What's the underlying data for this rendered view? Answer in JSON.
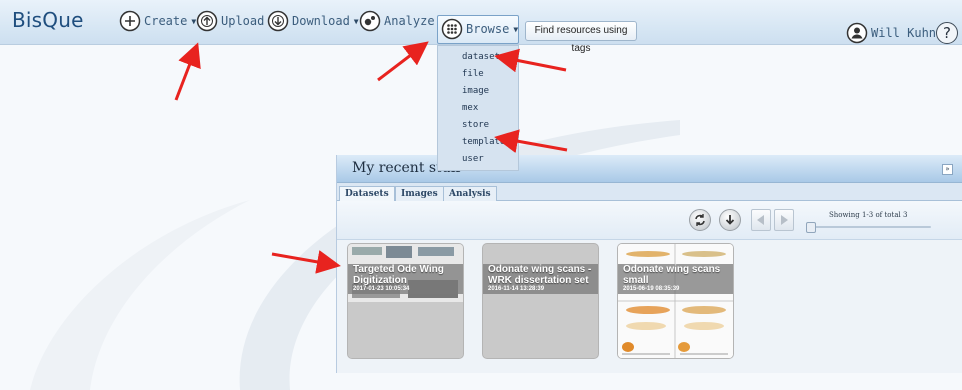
{
  "app": {
    "logo": "BisQue"
  },
  "nav": {
    "create": "Create",
    "upload": "Upload",
    "download": "Download",
    "analyze": "Analyze",
    "browse": "Browse",
    "tags_button": "Find resources using tags",
    "user": "Will Kuhn",
    "help": "?"
  },
  "browse_menu": {
    "items": [
      "dataset",
      "file",
      "image",
      "mex",
      "store",
      "template",
      "user"
    ]
  },
  "recent": {
    "title": "My recent stuff",
    "tabs": [
      "Datasets",
      "Images",
      "Analysis"
    ],
    "showing": "Showing 1-3 of total 3",
    "cards": [
      {
        "title": "Targeted Ode Wing Digitization",
        "date": "2017-01-23 10:05:34"
      },
      {
        "title": "Odonate wing scans - WRK dissertation set",
        "date": "2016-11-14 13:28:39"
      },
      {
        "title": "Odonate wing scans small",
        "date": "2015-06-19 08:35:39"
      }
    ]
  },
  "colors": {
    "topbar": "#d5e5f3",
    "accent": "#1f4e7e",
    "annotation_arrow": "#e8231f",
    "card_bg": "#c9c9c9"
  },
  "icons": [
    "plus-circle-icon",
    "upload-icon",
    "download-icon",
    "analyze-icon",
    "browse-grid-icon",
    "user-icon",
    "help-icon",
    "refresh-icon",
    "download-icon",
    "prev-arrow-icon",
    "next-arrow-icon",
    "collapse-icon"
  ]
}
